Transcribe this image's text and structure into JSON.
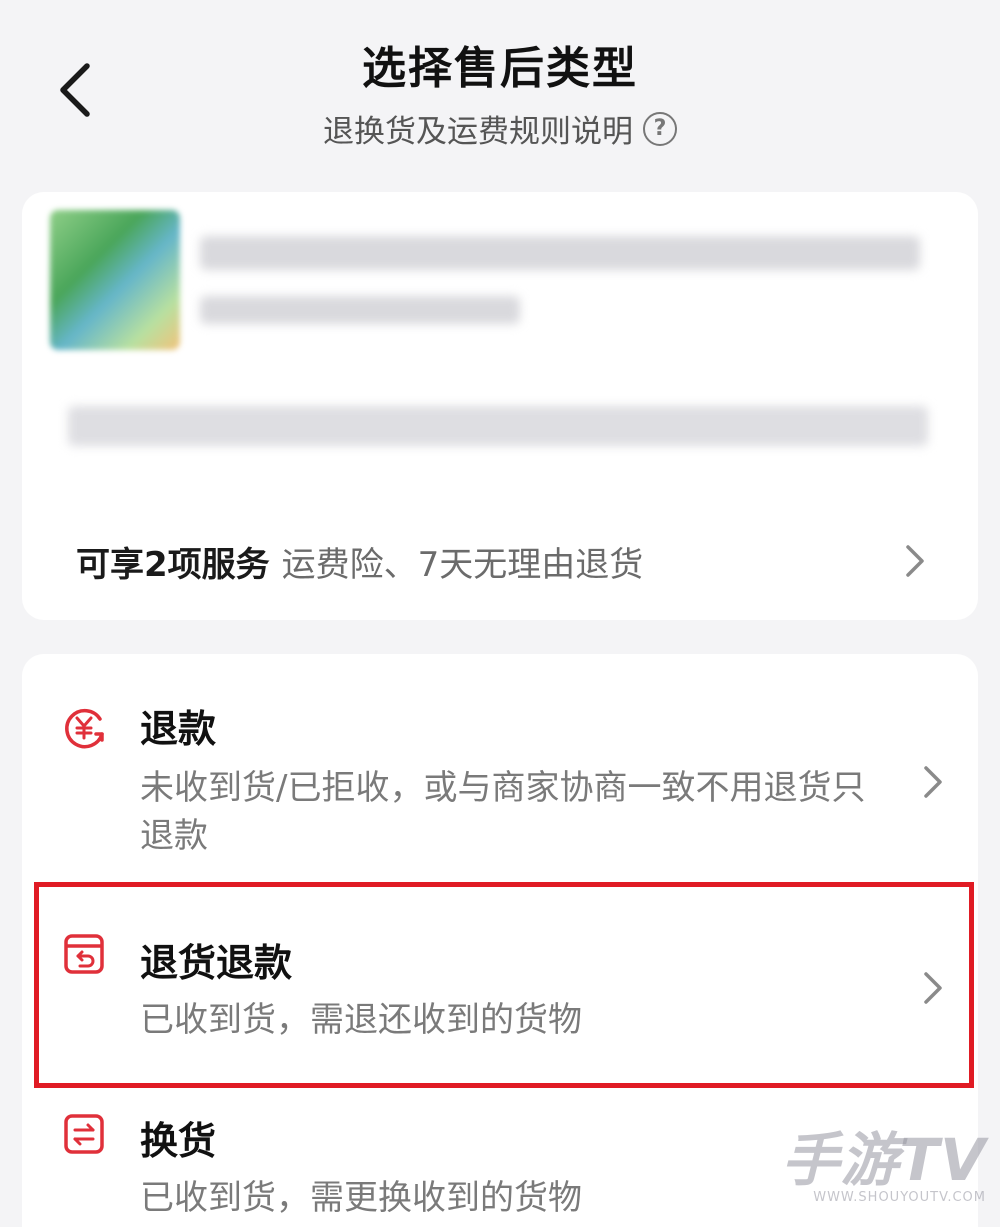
{
  "header": {
    "title": "选择售后类型",
    "subtitle": "退换货及运费规则说明",
    "help_icon_glyph": "?"
  },
  "product": {
    "services_strong": "可享2项服务",
    "services_detail": "运费险、7天无理由退货"
  },
  "options": [
    {
      "title": "退款",
      "desc": "未收到货/已拒收，或与商家协商一致不用退货只退款",
      "icon": "refund-yen-icon"
    },
    {
      "title": "退货退款",
      "desc": "已收到货，需退还收到的货物",
      "icon": "return-box-icon"
    },
    {
      "title": "换货",
      "desc": "已收到货，需更换收到的货物",
      "icon": "exchange-icon"
    }
  ],
  "watermark": {
    "main": "手游TV",
    "url": "WWW.SHOUYOUTV.COM"
  },
  "colors": {
    "accent": "#e0303a",
    "highlight": "#e01b24",
    "background": "#f4f4f6"
  }
}
